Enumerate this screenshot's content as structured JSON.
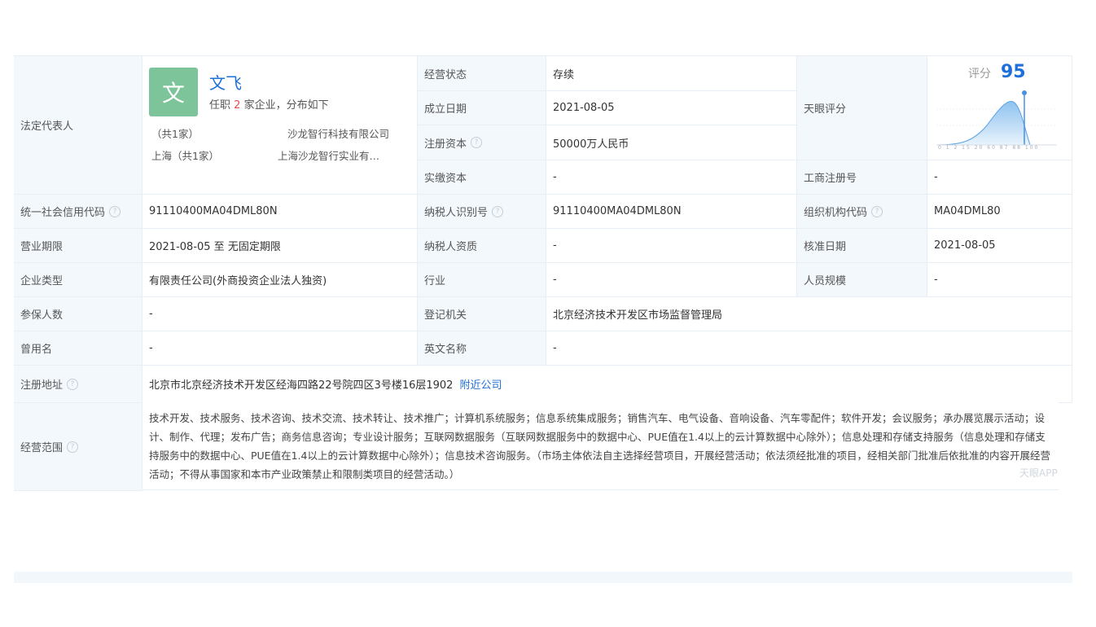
{
  "legal_rep": {
    "label": "法定代表人",
    "avatar_char": "文",
    "name": "文飞",
    "positions_prefix": "任职",
    "positions_count": "2",
    "positions_suffix": "家企业，分布如下",
    "region1": "（共1家）",
    "region1_company": "沙龙智行科技有限公司",
    "region2": "上海（共1家）",
    "region2_company": "上海沙龙智行实业有…"
  },
  "rows": {
    "status_label": "经营状态",
    "status_value": "存续",
    "founded_label": "成立日期",
    "founded_value": "2021-08-05",
    "capital_label": "注册资本",
    "capital_value": "50000万人民币",
    "paid_label": "实缴资本",
    "paid_value": "-",
    "score_label": "天眼评分",
    "score_prefix": "评分",
    "score_value": "95",
    "score_ticks": "0 1 2 15 20 60 87 88 100",
    "biz_reg_label": "工商注册号",
    "biz_reg_value": "-",
    "credit_label": "统一社会信用代码",
    "credit_value": "91110400MA04DML80N",
    "taxpayer_label": "纳税人识别号",
    "taxpayer_value": "91110400MA04DML80N",
    "org_label": "组织机构代码",
    "org_value": "MA04DML80",
    "term_label": "营业期限",
    "term_value": "2021-08-05  至  无固定期限",
    "tax_qual_label": "纳税人资质",
    "tax_qual_value": "-",
    "approve_label": "核准日期",
    "approve_value": "2021-08-05",
    "type_label": "企业类型",
    "type_value": "有限责任公司(外商投资企业法人独资)",
    "industry_label": "行业",
    "industry_value": "-",
    "staff_label": "人员规模",
    "staff_value": "-",
    "insured_label": "参保人数",
    "insured_value": "-",
    "authority_label": "登记机关",
    "authority_value": "北京经济技术开发区市场监督管理局",
    "former_label": "曾用名",
    "former_value": "-",
    "english_label": "英文名称",
    "english_value": "-",
    "address_label": "注册地址",
    "address_value": "北京市北京经济技术开发区经海四路22号院四区3号楼16层1902",
    "nearby_link": "附近公司",
    "scope_label": "经营范围",
    "scope_value": "技术开发、技术服务、技术咨询、技术交流、技术转让、技术推广；计算机系统服务；信息系统集成服务；销售汽车、电气设备、音响设备、汽车零配件；软件开发；会议服务；承办展览展示活动；设计、制作、代理；发布广告；商务信息咨询；专业设计服务；互联网数据服务（互联网数据服务中的数据中心、PUE值在1.4以上的云计算数据中心除外）；信息处理和存储支持服务（信息处理和存储支持服务中的数据中心、PUE值在1.4以上的云计算数据中心除外）；信息技术咨询服务。（市场主体依法自主选择经营项目，开展经营活动；依法须经批准的项目，经相关部门批准后依批准的内容开展经营活动；不得从事国家和本市产业政策禁止和限制类项目的经营活动。）",
    "watermark": "天眼APP"
  },
  "colors": {
    "label_bg": "#f3f8fd",
    "link": "#1e6fd9",
    "score": "#1e6fd9",
    "avatar": "#7dc49a",
    "count": "#e94f4f"
  }
}
